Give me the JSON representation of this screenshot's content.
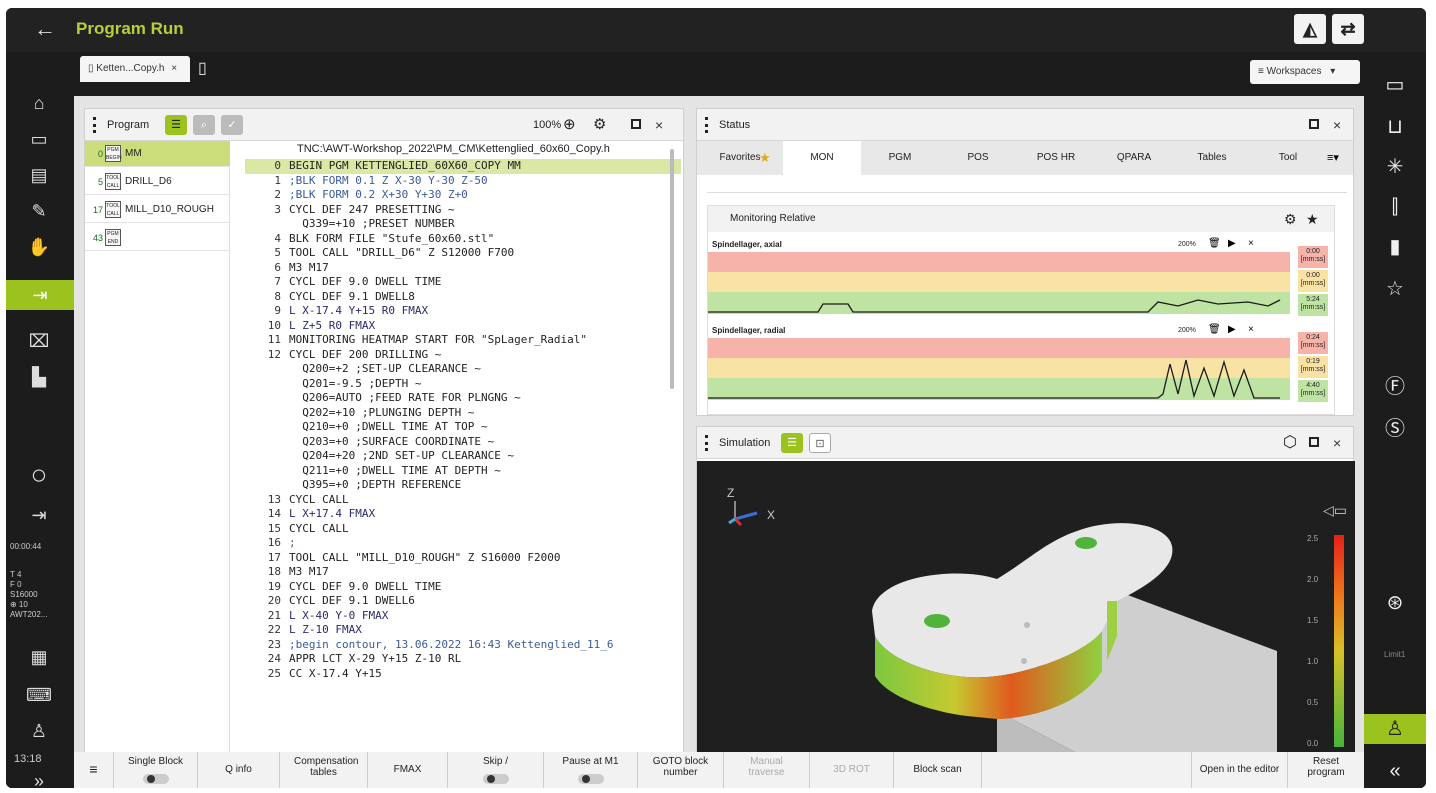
{
  "header": {
    "back": "←",
    "title": "Program Run"
  },
  "tabs": {
    "file_tab": "Ketten...Copy.h",
    "close": "×",
    "workspaces": "Workspaces"
  },
  "left_sidebar": {
    "time": "00:00:44",
    "t_line": "T 4",
    "f_line": "F 0",
    "s_line": "S16000",
    "q_line": "⊕ 10",
    "awt_line": "AWT202...",
    "clock": "13:18",
    "expand": "»"
  },
  "right_sidebar": {
    "limit": "Limit1",
    "collapse": "«"
  },
  "program_panel": {
    "title": "Program",
    "zoom": "100%",
    "path": "TNC:\\AWT-Workshop_2022\\PM_CM\\Kettenglied_60x60_Copy.h",
    "outline": [
      {
        "num": "0",
        "icon": "PGM BEGIN",
        "label": "MM"
      },
      {
        "num": "5",
        "icon": "TOOL CALL",
        "label": "DRILL_D6"
      },
      {
        "num": "17",
        "icon": "TOOL CALL",
        "label": "MILL_D10_ROUGH"
      },
      {
        "num": "43",
        "icon": "PGM END",
        "label": ""
      }
    ],
    "code": [
      {
        "n": "0",
        "t": "BEGIN PGM KETTENGLIED_60X60_COPY MM"
      },
      {
        "n": "1",
        "t": ";BLK FORM 0.1 Z X-30 Y-30 Z-50"
      },
      {
        "n": "2",
        "t": ";BLK FORM 0.2 X+30 Y+30 Z+0"
      },
      {
        "n": "3",
        "t": "CYCL DEF 247 PRESETTING ~"
      },
      {
        "n": "",
        "t": "  Q339=+10 ;PRESET NUMBER"
      },
      {
        "n": "4",
        "t": "BLK FORM FILE \"Stufe_60x60.stl\""
      },
      {
        "n": "5",
        "t": "TOOL CALL \"DRILL_D6\" Z S12000 F700"
      },
      {
        "n": "6",
        "t": "M3 M17"
      },
      {
        "n": "7",
        "t": "CYCL DEF 9.0 DWELL TIME"
      },
      {
        "n": "8",
        "t": "CYCL DEF 9.1 DWELL8"
      },
      {
        "n": "9",
        "t": "L X-17.4 Y+15 R0 FMAX"
      },
      {
        "n": "10",
        "t": "L Z+5 R0 FMAX"
      },
      {
        "n": "11",
        "t": "MONITORING HEATMAP START FOR \"SpLager_Radial\""
      },
      {
        "n": "12",
        "t": "CYCL DEF 200 DRILLING ~"
      },
      {
        "n": "",
        "t": "  Q200=+2 ;SET-UP CLEARANCE ~"
      },
      {
        "n": "",
        "t": "  Q201=-9.5 ;DEPTH ~"
      },
      {
        "n": "",
        "t": "  Q206=AUTO ;FEED RATE FOR PLNGNG ~"
      },
      {
        "n": "",
        "t": "  Q202=+10 ;PLUNGING DEPTH ~"
      },
      {
        "n": "",
        "t": "  Q210=+0 ;DWELL TIME AT TOP ~"
      },
      {
        "n": "",
        "t": "  Q203=+0 ;SURFACE COORDINATE ~"
      },
      {
        "n": "",
        "t": "  Q204=+20 ;2ND SET-UP CLEARANCE ~"
      },
      {
        "n": "",
        "t": "  Q211=+0 ;DWELL TIME AT DEPTH ~"
      },
      {
        "n": "",
        "t": "  Q395=+0 ;DEPTH REFERENCE"
      },
      {
        "n": "13",
        "t": "CYCL CALL"
      },
      {
        "n": "14",
        "t": "L X+17.4 FMAX"
      },
      {
        "n": "15",
        "t": "CYCL CALL"
      },
      {
        "n": "16",
        "t": ";"
      },
      {
        "n": "17",
        "t": "TOOL CALL \"MILL_D10_ROUGH\" Z S16000 F2000"
      },
      {
        "n": "18",
        "t": "M3 M17"
      },
      {
        "n": "19",
        "t": "CYCL DEF 9.0 DWELL TIME"
      },
      {
        "n": "20",
        "t": "CYCL DEF 9.1 DWELL6"
      },
      {
        "n": "21",
        "t": "L X-40 Y-0 FMAX"
      },
      {
        "n": "22",
        "t": "L Z-10 FMAX"
      },
      {
        "n": "23",
        "t": ";begin contour, 13.06.2022 16:43 Kettenglied_11_6"
      },
      {
        "n": "24",
        "t": "APPR LCT X-29 Y+15 Z-10 RL"
      },
      {
        "n": "25",
        "t": "CC X-17.4 Y+15"
      }
    ]
  },
  "status_panel": {
    "title": "Status",
    "tabs": [
      "Favorites",
      "MON",
      "PGM",
      "POS",
      "POS HR",
      "QPARA",
      "Tables",
      "Tool"
    ],
    "active_tab": "MON",
    "monitoring_title": "Monitoring Relative",
    "heatmaps": [
      {
        "label": "Spindellager, axial",
        "zoom": "200%",
        "badges": [
          [
            "0:00",
            "[mm:ss]"
          ],
          [
            "0:00",
            "[mm:ss]"
          ],
          [
            "5:24",
            "[mm:ss]"
          ]
        ]
      },
      {
        "label": "Spindellager, radial",
        "zoom": "200%",
        "badges": [
          [
            "0:24",
            "[mm:ss]"
          ],
          [
            "0:19",
            "[mm:ss]"
          ],
          [
            "4:40",
            "[mm:ss]"
          ]
        ]
      }
    ]
  },
  "simulation_panel": {
    "title": "Simulation",
    "axis_z": "Z",
    "axis_x": "X",
    "scale": [
      "2.5",
      "2.0",
      "1.5",
      "1.0",
      "0.5",
      "0.0"
    ]
  },
  "bottom_bar": {
    "menu": "≡",
    "single_block": "Single Block",
    "q_info": "Q info",
    "compensation": "Compensation tables",
    "fmax": "FMAX",
    "skip": "Skip /",
    "pause": "Pause at M1",
    "goto": "GOTO block number",
    "manual": "Manual traverse",
    "rot": "3D ROT",
    "block_scan": "Block scan",
    "open_editor": "Open in the editor",
    "reset": "Reset program"
  },
  "colors": {
    "accent": "#9bc21e",
    "title": "#b6cf3a",
    "red_band": "#f6b3aa",
    "yellow_band": "#f9e3a4",
    "green_band": "#bfe3a2"
  }
}
